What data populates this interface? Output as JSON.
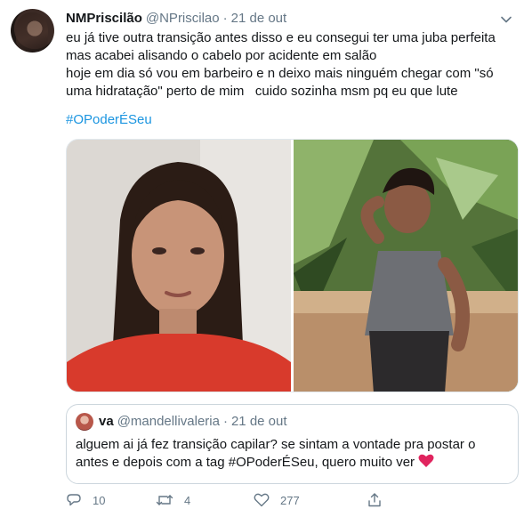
{
  "tweet": {
    "author_name": "NMPriscilão",
    "handle": "@NPriscilao",
    "separator": "·",
    "date": "21 de out",
    "body_lines": [
      "eu já tive outra transição antes disso e eu consegui ter uma juba perfeita",
      "mas acabei alisando o cabelo por acidente em salão",
      "hoje em dia só vou em barbeiro e n deixo mais ninguém chegar com \"só",
      "uma hidratação\" perto de mim   cuido sozinha msm pq eu que lute"
    ],
    "hashtag": "#OPoderÉSeu"
  },
  "quoted_tweet": {
    "author_name": "va",
    "handle": "@mandellivaleria",
    "separator": "·",
    "date": "21 de out",
    "body_lines": [
      "alguem ai já fez transição capilar? se sintam a vontade pra postar o",
      "antes e depois com a tag #OPoderÉSeu, quero muito ver"
    ]
  },
  "actions": {
    "reply_count": "10",
    "retweet_count": "4",
    "like_count": "277"
  },
  "colors": {
    "link": "#1b95e0",
    "muted": "#657786",
    "heart": "#e0245e"
  },
  "icons": [
    "caret-down-icon",
    "reply-icon",
    "retweet-icon",
    "like-icon",
    "share-icon",
    "heart-emoji-icon"
  ]
}
